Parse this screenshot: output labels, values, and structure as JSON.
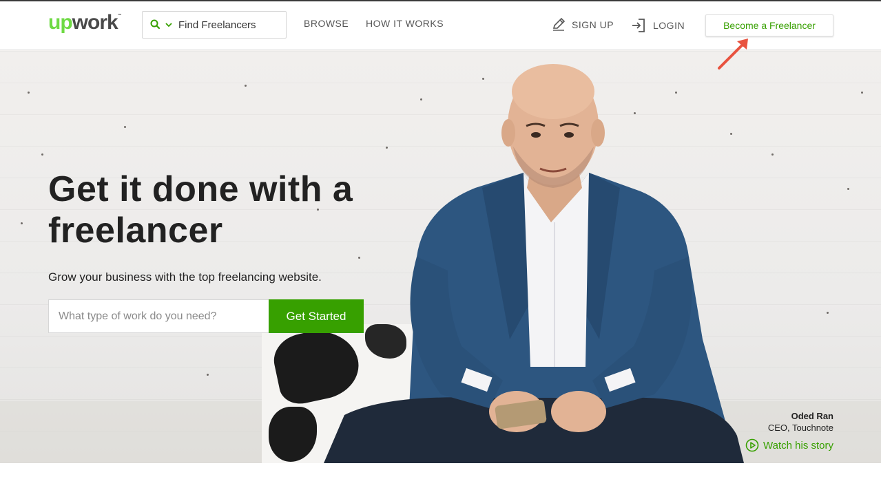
{
  "header": {
    "logo_up": "up",
    "logo_work": "work",
    "search_label": "Find Freelancers",
    "nav": {
      "browse": "BROWSE",
      "how_it_works": "HOW IT WORKS"
    },
    "sign_up": "SIGN UP",
    "login": "LOGIN",
    "become_freelancer": "Become a Freelancer"
  },
  "hero": {
    "headline": "Get it done with a freelancer",
    "subline": "Grow your business with the top freelancing website.",
    "search_placeholder": "What type of work do you need?",
    "cta": "Get Started",
    "caption": {
      "name": "Oded Ran",
      "role": "CEO, Touchnote",
      "watch": "Watch his story"
    }
  },
  "colors": {
    "brand_green": "#37a000",
    "logo_green": "#6fda44",
    "annotation_arrow": "#e8523f",
    "text_dark": "#222222"
  },
  "icons": [
    "search-icon",
    "chevron-down-icon",
    "pencil-icon",
    "login-icon",
    "play-circle-icon",
    "annotation-arrow-icon"
  ]
}
